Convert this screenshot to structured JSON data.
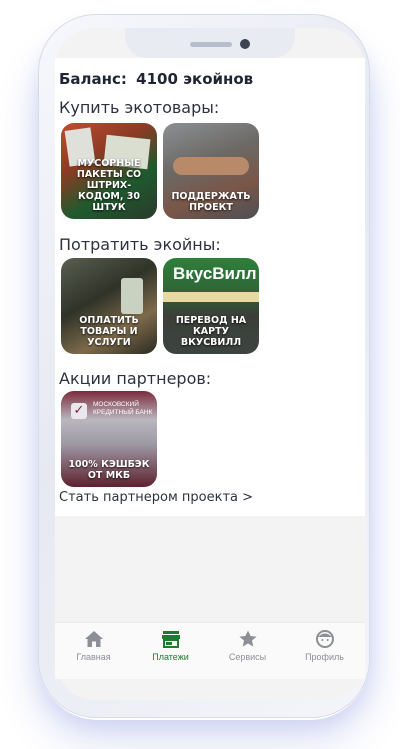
{
  "balance": {
    "label": "Баланс:",
    "amount": "4100 экойнов"
  },
  "sections": [
    {
      "title": "Купить экотовары:",
      "tiles": [
        {
          "caption": "МУСОРНЫЕ ПАКЕТЫ СО ШТРИХ-КОДОМ, 30 ШТУК",
          "image": "trash-bags-photo"
        },
        {
          "caption": "ПОДДЕРЖАТЬ ПРОЕКТ",
          "image": "joined-hands-photo"
        }
      ]
    },
    {
      "title": "Потратить экойны:",
      "tiles": [
        {
          "caption": "ОПЛАТИТЬ ТОВАРЫ И УСЛУГИ",
          "image": "phone-payment-photo"
        },
        {
          "caption": "ПЕРЕВОД НА КАРТУ ВКУСВИЛЛ",
          "image": "vkusvill-store-photo",
          "logo_text": "ВкусВилл"
        }
      ]
    },
    {
      "title": "Акции партнеров:",
      "tiles": [
        {
          "caption": "100% КЭШБЭК ОТ МКБ",
          "image": "mkb-bank-photo",
          "logo_text": "Московский кредитный банк"
        }
      ]
    }
  ],
  "partner_link": "Стать партнером проекта >",
  "tabbar": {
    "items": [
      {
        "label": "Главная",
        "icon": "home-icon",
        "active": false
      },
      {
        "label": "Платежи",
        "icon": "store-icon",
        "active": true
      },
      {
        "label": "Сервисы",
        "icon": "star-icon",
        "active": false
      },
      {
        "label": "Профиль",
        "icon": "face-icon",
        "active": false
      }
    ]
  },
  "colors": {
    "active_tab": "#1f7a33",
    "inactive_tab": "#8c8f96",
    "text_dark": "#1f2533"
  }
}
